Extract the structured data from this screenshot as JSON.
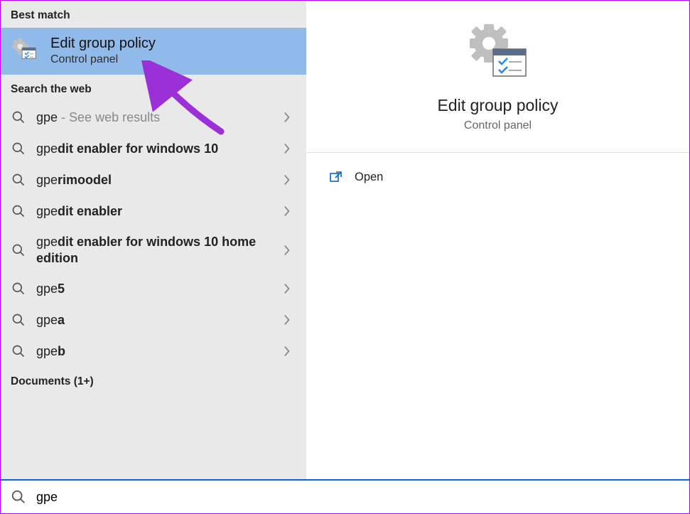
{
  "sections": {
    "best_match_header": "Best match",
    "search_web_header": "Search the web",
    "documents_header": "Documents (1+)"
  },
  "best_match": {
    "title": "Edit group policy",
    "subtitle": "Control panel",
    "icon": "group-policy-icon"
  },
  "web_results": [
    {
      "prefix": "gpe",
      "bold": "",
      "suffix_light": " - See web results"
    },
    {
      "prefix": "gpe",
      "bold": "dit enabler for windows 10",
      "suffix_light": ""
    },
    {
      "prefix": "gpe",
      "bold": "rimoodel",
      "suffix_light": ""
    },
    {
      "prefix": "gpe",
      "bold": "dit enabler",
      "suffix_light": ""
    },
    {
      "prefix": "gpe",
      "bold": "dit enabler for windows 10 home edition",
      "suffix_light": ""
    },
    {
      "prefix": "gpe",
      "bold": "5",
      "suffix_light": ""
    },
    {
      "prefix": "gpe",
      "bold": "a",
      "suffix_light": ""
    },
    {
      "prefix": "gpe",
      "bold": "b",
      "suffix_light": ""
    }
  ],
  "preview": {
    "title": "Edit group policy",
    "subtitle": "Control panel",
    "icon": "group-policy-icon"
  },
  "actions": {
    "open": "Open"
  },
  "search": {
    "value": "gpe",
    "placeholder": ""
  },
  "glyphs": {
    "chevron": "›"
  },
  "annotation": {
    "arrow_color": "#9b2fd8"
  }
}
